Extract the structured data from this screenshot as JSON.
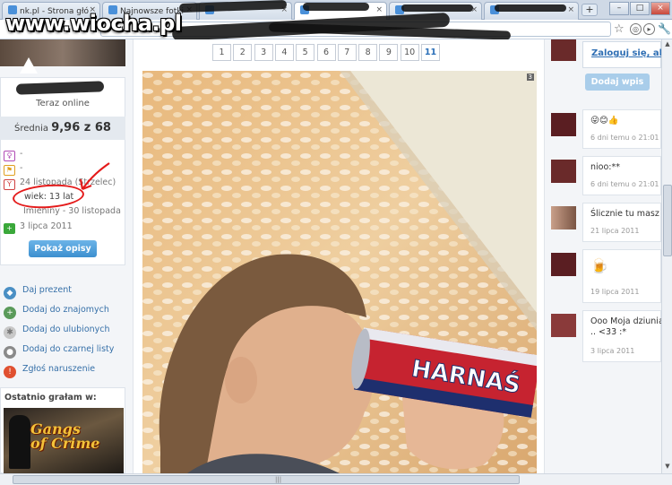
{
  "watermark": "www.wiocha.pl",
  "browser": {
    "tabs": [
      {
        "label": "nk.pl - Strona głó",
        "active": false
      },
      {
        "label": "Najnowsze fotki",
        "active": false
      },
      {
        "label": "",
        "active": false
      },
      {
        "label": "",
        "active": true
      },
      {
        "label": "",
        "active": false
      },
      {
        "label": "",
        "active": false
      }
    ],
    "tab_close": "×",
    "new_tab": "+",
    "window_buttons": [
      "–",
      "□",
      "×"
    ]
  },
  "sidebar": {
    "status": "Teraz online",
    "rating_label": "Średnia",
    "rating_value": "9,96 z 68",
    "info": [
      {
        "icon": "profile-icon",
        "text": "-"
      },
      {
        "icon": "flag-icon",
        "text": "-"
      },
      {
        "icon": "birthday-icon",
        "text": "24 listopada (Strzelec)"
      },
      {
        "icon": "name-day-icon",
        "text": "Imieniny - 30 listopada"
      },
      {
        "icon": "joined-icon",
        "text": "3 lipca 2011"
      }
    ],
    "age_annotation": "wiek: 13 lat",
    "show_descriptions": "Pokaż opisy",
    "actions": [
      {
        "icon": "gift-icon",
        "label": "Daj prezent"
      },
      {
        "icon": "add-friend-icon",
        "label": "Dodaj do znajomych"
      },
      {
        "icon": "favorite-icon",
        "label": "Dodaj do ulubionych"
      },
      {
        "icon": "blacklist-icon",
        "label": "Dodaj do czarnej listy"
      },
      {
        "icon": "report-icon",
        "label": "Zgłoś naruszenie"
      }
    ],
    "played_title": "Ostatnio grałam w:",
    "game_title_line1": "Gangs",
    "game_title_line2": "of Crime"
  },
  "main": {
    "pages": [
      "1",
      "2",
      "3",
      "4",
      "5",
      "6",
      "7",
      "8",
      "9",
      "10",
      "11"
    ],
    "current_page": "11",
    "photo_badge": "3"
  },
  "comments_panel": {
    "login_link": "Zaloguj się, aby",
    "add_entry": "Dodaj wpis",
    "comments": [
      {
        "text": "😜😊👍",
        "date": "6 dni temu o 21:01"
      },
      {
        "text": "nioo:**",
        "date": "6 dni temu o 21:01"
      },
      {
        "text": "Ślicznie tu masz",
        "date": "21 lipca 2011"
      },
      {
        "text": "🍺",
        "date": "19 lipca 2011"
      },
      {
        "text": "Ooo Moja dziunia",
        "text2": ".. <33 :*",
        "date": "3 lipca 2011"
      }
    ]
  },
  "colors": {
    "link": "#3670a8",
    "button": "#3c8fcf",
    "annotation": "#e41b1b"
  }
}
